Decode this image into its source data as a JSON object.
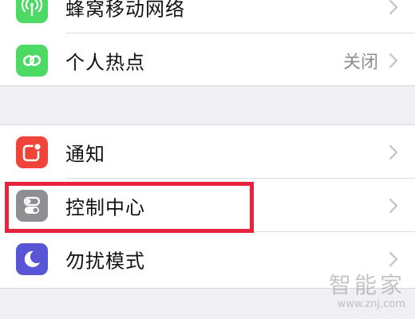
{
  "settings": {
    "group1": [
      {
        "label": "蜂窝移动网络",
        "detail": "",
        "icon": "cellular-antenna-icon",
        "color": "#4cd964"
      },
      {
        "label": "个人热点",
        "detail": "关闭",
        "icon": "hotspot-link-icon",
        "color": "#4cd964"
      }
    ],
    "group2": [
      {
        "label": "通知",
        "detail": "",
        "icon": "notifications-icon",
        "color": "#f0433a"
      },
      {
        "label": "控制中心",
        "detail": "",
        "icon": "control-center-icon",
        "color": "#8e8e93"
      },
      {
        "label": "勿扰模式",
        "detail": "",
        "icon": "moon-icon",
        "color": "#5856d6"
      }
    ]
  },
  "highlight": {
    "target": "控制中心",
    "color": "#e8233f"
  },
  "watermark": {
    "text_cn": "智能家",
    "url": "www.znj.com"
  }
}
